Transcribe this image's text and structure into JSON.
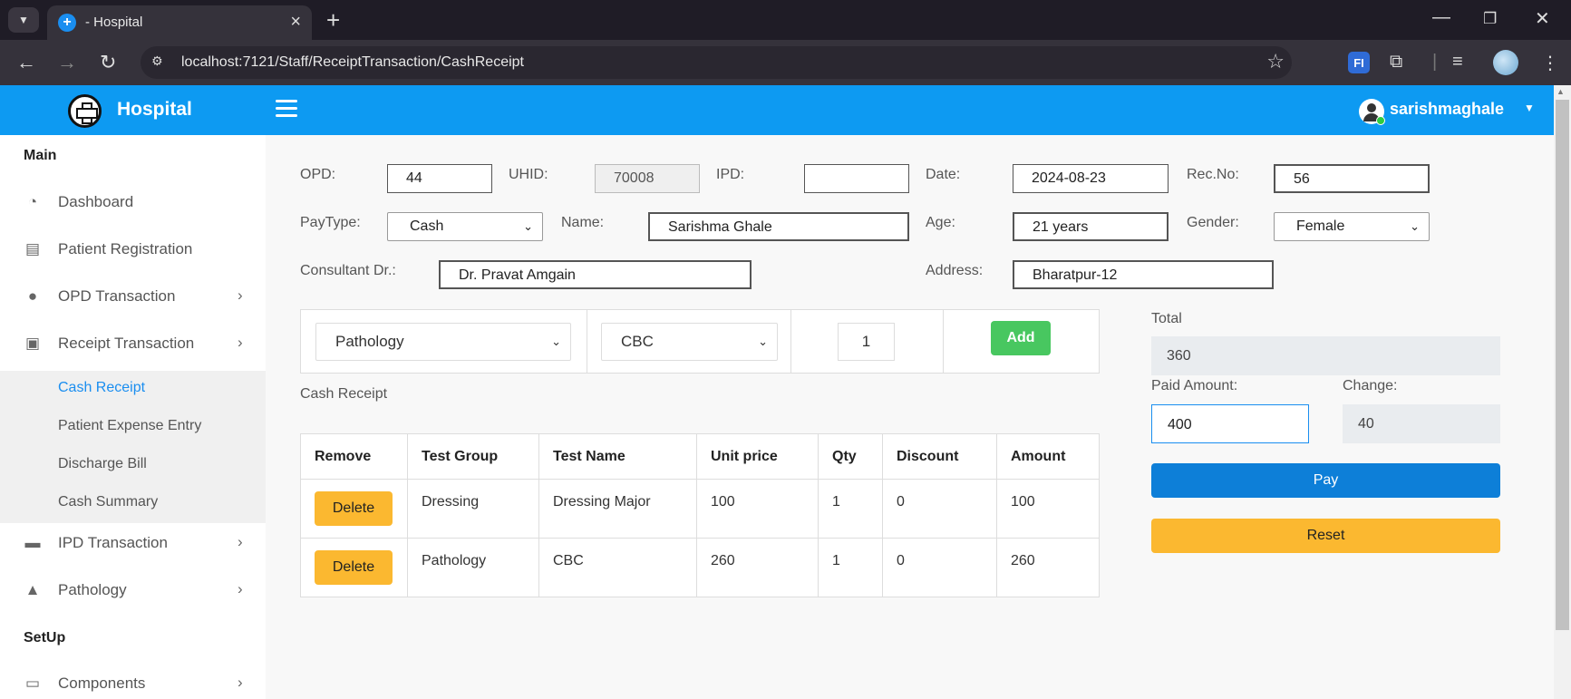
{
  "browser": {
    "tab_title": "- Hospital",
    "url": "localhost:7121/Staff/ReceiptTransaction/CashReceipt"
  },
  "header": {
    "brand": "Hospital",
    "username": "sarishmaghale"
  },
  "sidebar": {
    "main_label": "Main",
    "items": [
      {
        "label": "Dashboard",
        "icon": "dashboard-icon"
      },
      {
        "label": "Patient Registration",
        "icon": "id-card-icon"
      },
      {
        "label": "OPD Transaction",
        "icon": "user-icon"
      },
      {
        "label": "Receipt Transaction",
        "icon": "money-icon"
      }
    ],
    "sub_items": [
      {
        "label": "Cash Receipt",
        "active": true
      },
      {
        "label": "Patient Expense Entry"
      },
      {
        "label": "Discharge Bill"
      },
      {
        "label": "Cash Summary"
      }
    ],
    "items_after": [
      {
        "label": "IPD Transaction",
        "icon": "bed-icon"
      },
      {
        "label": "Pathology",
        "icon": "drop-icon"
      }
    ],
    "setup_label": "SetUp",
    "setup_items": [
      {
        "label": "Components",
        "icon": "laptop-icon"
      }
    ]
  },
  "form": {
    "opd_label": "OPD:",
    "opd_value": "44",
    "uhid_label": "UHID:",
    "uhid_value": "70008",
    "ipd_label": "IPD:",
    "ipd_value": "",
    "date_label": "Date:",
    "date_value": "2024-08-23",
    "recno_label": "Rec.No:",
    "recno_value": "56",
    "paytype_label": "PayType:",
    "paytype_value": "Cash",
    "name_label": "Name:",
    "name_value": "Sarishma  Ghale",
    "age_label": "Age:",
    "age_value": "21 years",
    "gender_label": "Gender:",
    "gender_value": "Female",
    "consultant_label": "Consultant Dr.:",
    "consultant_value": "Dr. Pravat Amgain",
    "address_label": "Address:",
    "address_value": "Bharatpur-12"
  },
  "entry": {
    "test_group": "Pathology",
    "test_name": "CBC",
    "qty": "1",
    "add_label": "Add"
  },
  "section_title": "Cash Receipt",
  "table": {
    "headers": [
      "Remove",
      "Test Group",
      "Test Name",
      "Unit price",
      "Qty",
      "Discount",
      "Amount"
    ],
    "rows": [
      {
        "action": "Delete",
        "group": "Dressing",
        "name": "Dressing Major",
        "price": "100",
        "qty": "1",
        "discount": "0",
        "amount": "100"
      },
      {
        "action": "Delete",
        "group": "Pathology",
        "name": "CBC",
        "price": "260",
        "qty": "1",
        "discount": "0",
        "amount": "260"
      }
    ]
  },
  "summary": {
    "total_label": "Total",
    "total_value": "360",
    "paid_label": "Paid Amount:",
    "paid_value": "400",
    "change_label": "Change:",
    "change_value": "40",
    "pay_label": "Pay",
    "reset_label": "Reset"
  },
  "colors": {
    "header_blue": "#0d9af2",
    "pay_blue": "#0d7fd8",
    "add_green": "#48c760",
    "warning_yellow": "#fbb830",
    "active_link": "#1a8ef0"
  }
}
